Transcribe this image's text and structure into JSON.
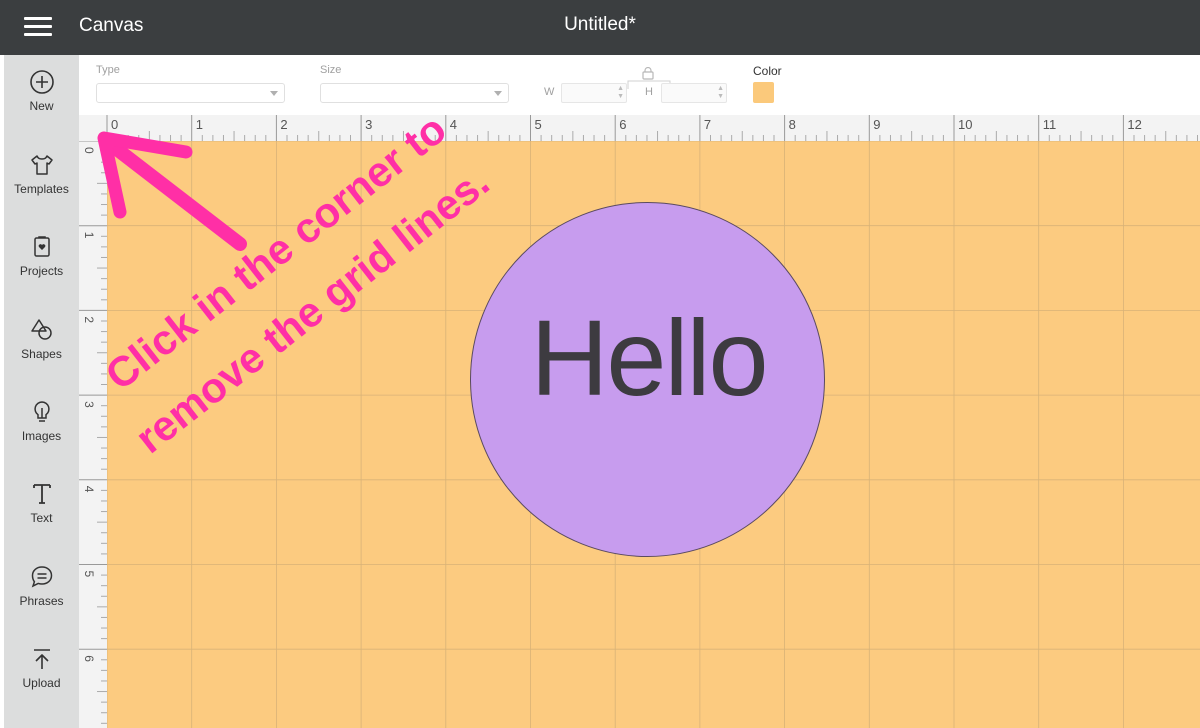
{
  "header": {
    "app_title": "Canvas",
    "document_title": "Untitled*"
  },
  "sidebar": {
    "items": [
      {
        "label": "New",
        "icon": "plus-circle-icon"
      },
      {
        "label": "Templates",
        "icon": "tshirt-icon"
      },
      {
        "label": "Projects",
        "icon": "project-heart-icon"
      },
      {
        "label": "Shapes",
        "icon": "shapes-icon"
      },
      {
        "label": "Images",
        "icon": "lightbulb-icon"
      },
      {
        "label": "Text",
        "icon": "text-t-icon"
      },
      {
        "label": "Phrases",
        "icon": "speech-bubble-icon"
      },
      {
        "label": "Upload",
        "icon": "upload-arrow-icon"
      }
    ]
  },
  "properties": {
    "type_label": "Type",
    "type_value": "",
    "size_label": "Size",
    "size_value": "",
    "width_label": "W",
    "width_value": "",
    "height_label": "H",
    "height_value": "",
    "color_label": "Color",
    "color_value": "#fbc97b"
  },
  "rulers": {
    "horizontal_numbers": [
      "0",
      "1",
      "2",
      "3",
      "4",
      "5",
      "6",
      "7",
      "8",
      "9",
      "10",
      "11",
      "12"
    ],
    "vertical_numbers": [
      "0",
      "1",
      "2",
      "3",
      "4",
      "5",
      "6"
    ]
  },
  "canvas": {
    "background_color": "#fccb80",
    "shape_fill": "#c79cee",
    "shape_text": "Hello"
  },
  "annotation": {
    "line1": "Click in the corner to",
    "line2": "remove the grid lines.",
    "color": "#ff2fa6"
  }
}
